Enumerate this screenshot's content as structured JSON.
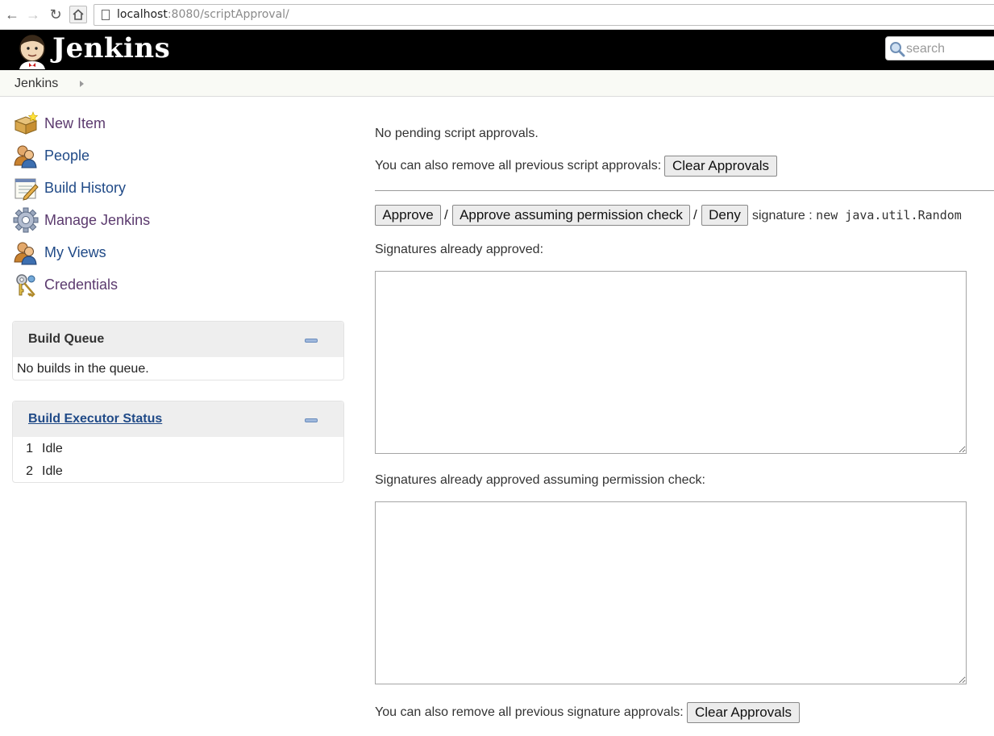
{
  "browser": {
    "url_host": "localhost",
    "url_path": ":8080/scriptApproval/"
  },
  "header": {
    "logo_text": "Jenkins",
    "search_placeholder": "search"
  },
  "breadcrumb": {
    "items": [
      "Jenkins"
    ]
  },
  "sidebar": {
    "tasks": [
      {
        "label": "New Item",
        "icon": "new-item-icon"
      },
      {
        "label": "People",
        "icon": "people-icon"
      },
      {
        "label": "Build History",
        "icon": "notepad-icon"
      },
      {
        "label": "Manage Jenkins",
        "icon": "gear-icon"
      },
      {
        "label": "My Views",
        "icon": "people-icon"
      },
      {
        "label": "Credentials",
        "icon": "keys-icon"
      }
    ],
    "build_queue": {
      "title": "Build Queue",
      "empty_text": "No builds in the queue."
    },
    "executor_status": {
      "title": "Build Executor Status",
      "executors": [
        {
          "number": "1",
          "status": "Idle"
        },
        {
          "number": "2",
          "status": "Idle"
        }
      ]
    }
  },
  "main": {
    "no_pending": "No pending script approvals.",
    "remove_scripts_text": "You can also remove all previous script approvals:",
    "clear_approvals_label": "Clear Approvals",
    "approve_label": "Approve",
    "approve_permission_label": "Approve assuming permission check",
    "deny_label": "Deny",
    "separator": "/",
    "signature_prefix": "signature :",
    "signature_code": "new java.util.Random",
    "approved_heading": "Signatures already approved:",
    "approved_perm_heading": "Signatures already approved assuming permission check:",
    "remove_signatures_text": "You can also remove all previous signature approvals:",
    "clear_signatures_label": "Clear Approvals"
  }
}
